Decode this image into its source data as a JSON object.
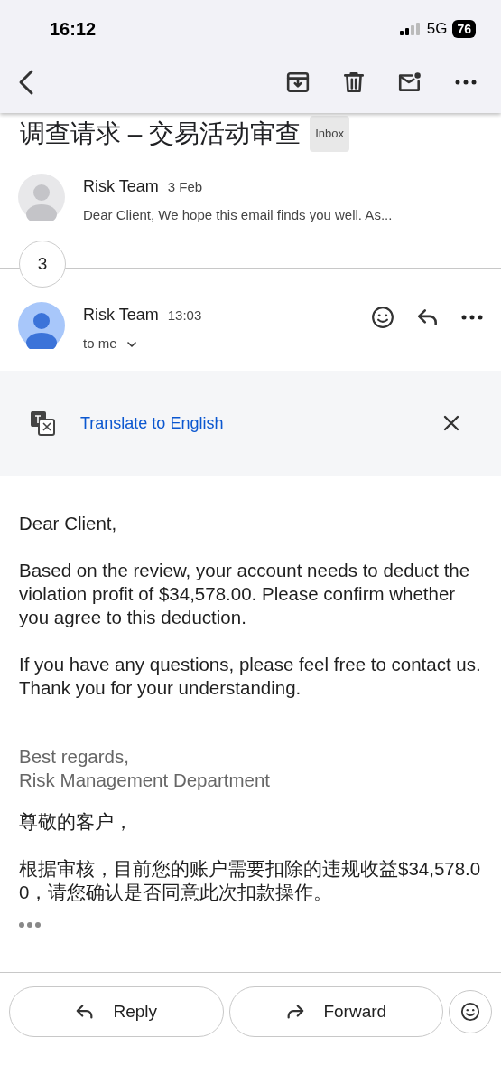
{
  "status_bar": {
    "time": "16:12",
    "network": "5G",
    "battery": "76"
  },
  "subject": {
    "text": "调查请求 – 交易活动审查",
    "label": "Inbox"
  },
  "messages": [
    {
      "sender": "Risk Team",
      "time": "3 Feb",
      "snippet": "Dear Client, We hope this email finds you well. As...",
      "expanded": false
    }
  ],
  "collapsed_count": "3",
  "open_message": {
    "sender": "Risk Team",
    "time": "13:03",
    "recipient": "to me"
  },
  "translate": {
    "link": "Translate to English"
  },
  "body": [
    "Dear Client,",
    "Based on the review, your account needs to deduct the violation profit of $34,578.00. Please confirm whether you agree to this deduction.",
    "If you have any questions, please feel free to contact us. Thank you for your understanding."
  ],
  "signature": [
    "Best regards,",
    "Risk Management Department"
  ],
  "body_cn": [
    "尊敬的客户，",
    "根据审核，目前您的账户需要扣除的违规收益$34,578.00，请您确认是否同意此次扣款操作。"
  ],
  "actions": [
    {
      "kind": "reply",
      "label": "Reply"
    },
    {
      "kind": "forward",
      "label": "Forward"
    },
    {
      "kind": "emoji"
    }
  ]
}
